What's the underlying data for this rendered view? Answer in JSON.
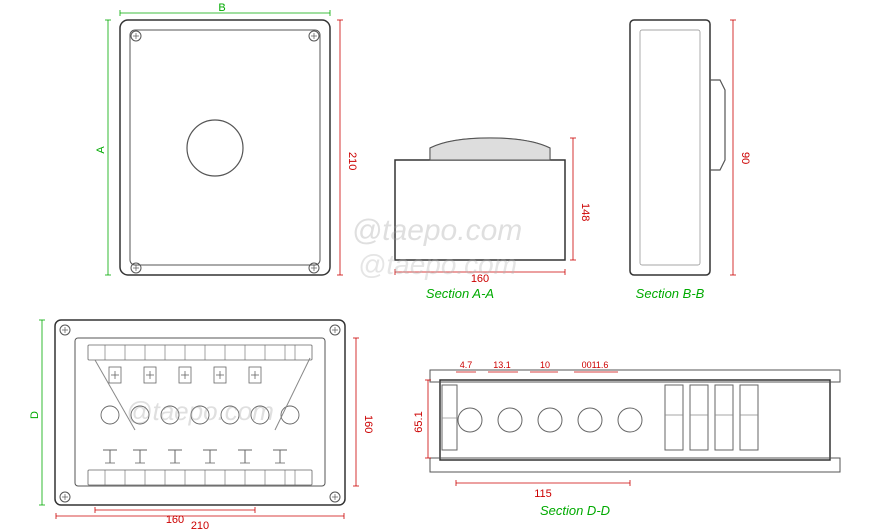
{
  "watermark": "@taepo.com",
  "dimensions": {
    "main_width": "210",
    "main_height": "A",
    "top_label": "B",
    "side_90": "90",
    "section_aa_width": "160",
    "section_aa_height": "148",
    "bottom_160": "160",
    "bottom_210": "210",
    "bottom_height": "160",
    "bottom_width_label": "D",
    "section_dd_47": "4.7",
    "section_dd_131": "13.1",
    "section_dd_10": "10",
    "section_dd_small": "0011.6",
    "section_dd_651": "65.1",
    "section_dd_115": "115",
    "section_aa_label": "Section A-A",
    "section_bb_label": "Section B-B",
    "section_dd_label": "Section D-D",
    "label_a": "A",
    "label_b": "B",
    "label_d": "D"
  }
}
